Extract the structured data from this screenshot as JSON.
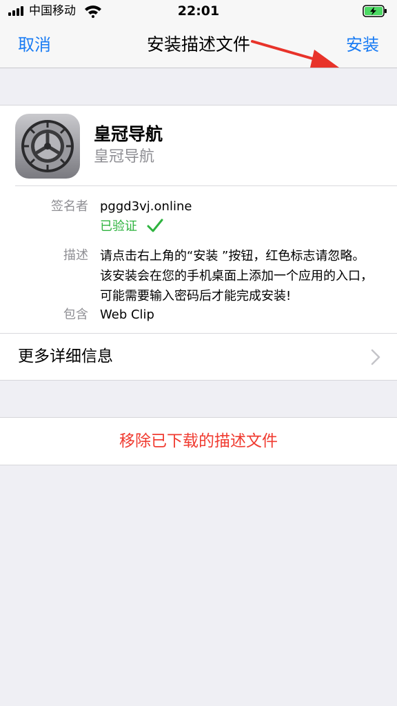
{
  "status": {
    "carrier": "中国移动",
    "time": "22:01"
  },
  "nav": {
    "cancel": "取消",
    "title": "安装描述文件",
    "install": "安装"
  },
  "profile": {
    "name": "皇冠导航",
    "subtitle": "皇冠导航",
    "signer_label": "签名者",
    "signer_value": "pggd3vj.online",
    "verified": "已验证",
    "desc_label": "描述",
    "desc_lines": [
      "请点击右上角的“安装 ”按钮，红色标志请忽略。",
      "该安装会在您的手机桌面上添加一个应用的入口，",
      "可能需要输入密码后才能完成安装!"
    ],
    "contains_label": "包含",
    "contains_value": "Web Clip",
    "more": "更多详细信息"
  },
  "remove": {
    "label": "移除已下载的描述文件"
  },
  "colors": {
    "accent": "#1a7cf4",
    "verified": "#2eb33f",
    "destructive": "#f03b30",
    "arrow": "#e8332a"
  }
}
